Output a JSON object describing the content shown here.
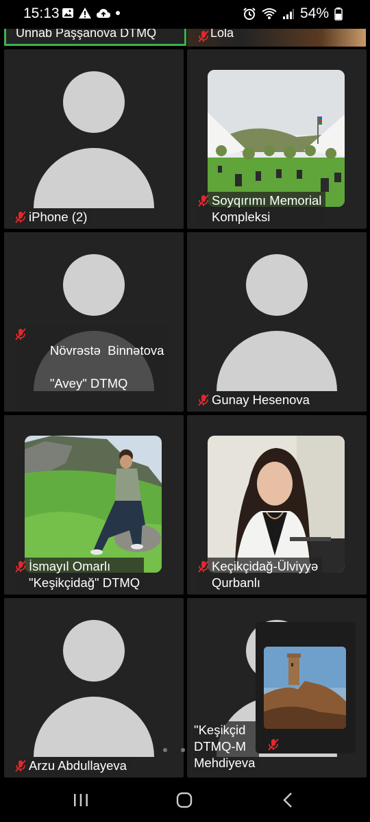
{
  "status_bar": {
    "time": "15:13",
    "battery_percent": "54%",
    "icons_left": [
      "gallery-icon",
      "alert-icon",
      "cloud-upload-icon",
      "dot-icon"
    ],
    "icons_right": [
      "alarm-icon",
      "wifi-icon",
      "signal-icon",
      "battery-icon"
    ]
  },
  "top_row": {
    "left_name": "Ünnab Paşşanova DTMQ",
    "right_name": "Lola",
    "active_speaker_color": "#3cb34a"
  },
  "participants": [
    {
      "name_lines": [
        "iPhone (2)"
      ],
      "type": "avatar",
      "muted": true
    },
    {
      "name_lines": [
        "Soyqırımı Memorial",
        "Kompleksi"
      ],
      "type": "photo",
      "photo": "memorial",
      "muted": true
    },
    {
      "name_lines": [
        "Növrəstə  Binnətova",
        "\"Avey\" DTMQ"
      ],
      "type": "avatar",
      "muted": true
    },
    {
      "name_lines": [
        "Gunay Hesenova"
      ],
      "type": "avatar",
      "muted": true
    },
    {
      "name_lines": [
        "İsmayıl Omarlı",
        "\"Keşikçidağ\" DTMQ"
      ],
      "type": "photo",
      "photo": "hill-man",
      "muted": true
    },
    {
      "name_lines": [
        "Keçikçidağ-Ülviyyə",
        "Qurbanlı"
      ],
      "type": "photo",
      "photo": "woman-portrait",
      "muted": true
    },
    {
      "name_lines": [
        "Arzu Abdullayeva"
      ],
      "type": "avatar",
      "muted": true
    },
    {
      "name_lines": [
        "\"Keşikçid",
        "DTMQ-M",
        "Mehdiyeva"
      ],
      "type": "avatar",
      "muted": false
    }
  ],
  "self_view": {
    "photo": "fortress-tower",
    "muted": true
  },
  "pager": {
    "pages": 2,
    "current": 1
  },
  "nav_bar": {
    "recents": "recents-icon",
    "home": "home-icon",
    "back": "back-icon"
  },
  "colors": {
    "tile_bg": "#232323",
    "avatar": "#d0d0d0",
    "mic_off": "#e0282e"
  }
}
